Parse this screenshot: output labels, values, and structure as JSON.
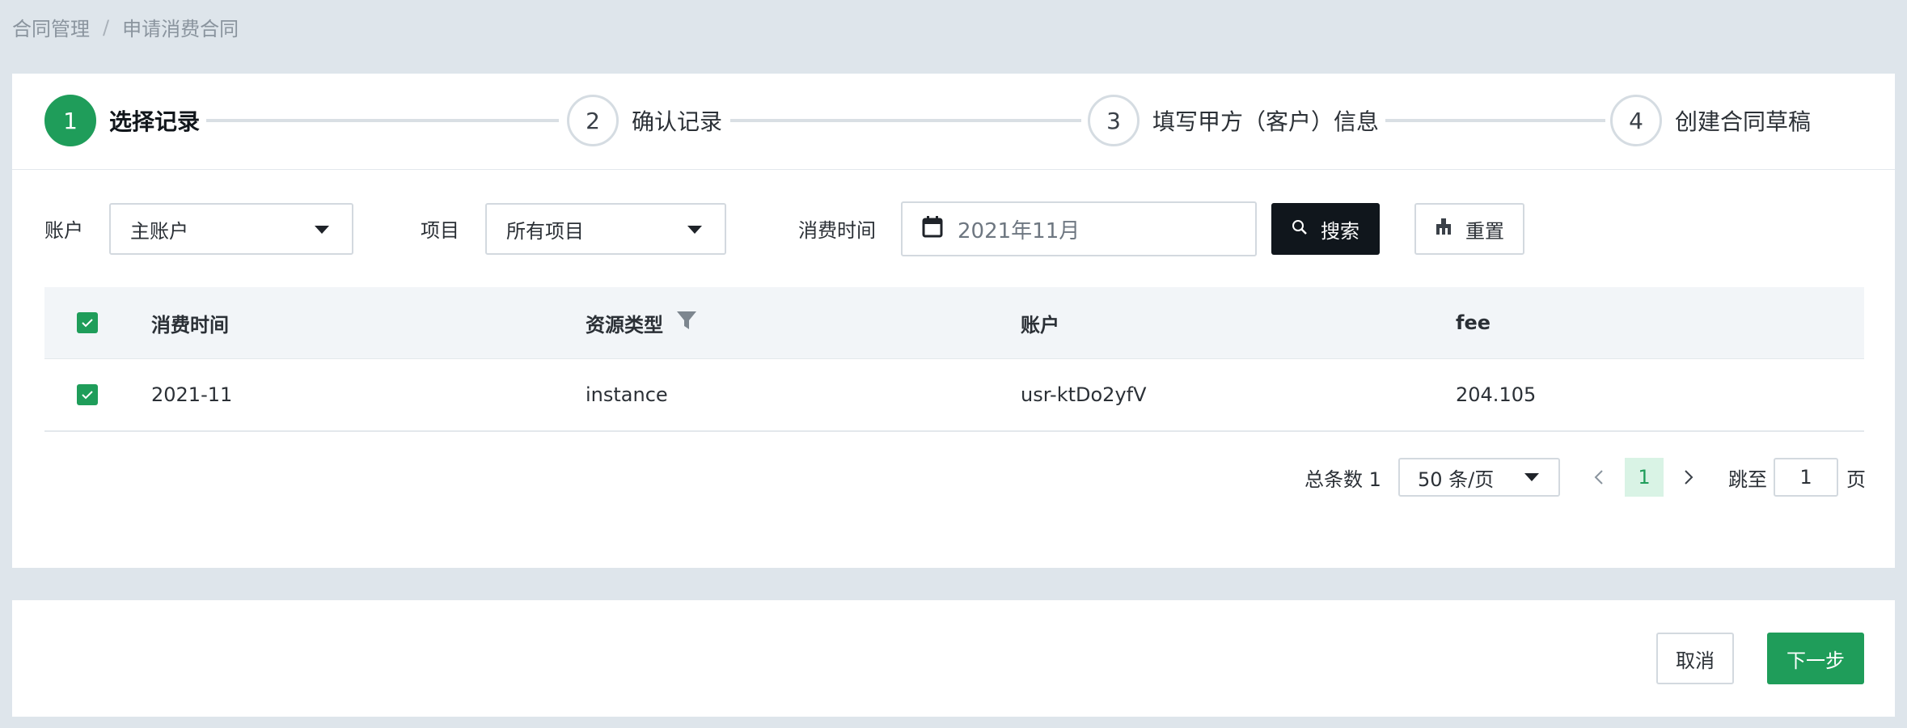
{
  "breadcrumb": {
    "items": [
      "合同管理",
      "申请消费合同"
    ],
    "separator": "/"
  },
  "steps": [
    {
      "num": "1",
      "label": "选择记录"
    },
    {
      "num": "2",
      "label": "确认记录"
    },
    {
      "num": "3",
      "label": "填写甲方（客户）信息"
    },
    {
      "num": "4",
      "label": "创建合同草稿"
    }
  ],
  "filters": {
    "account_label": "账户",
    "account_value": "主账户",
    "project_label": "项目",
    "project_value": "所有项目",
    "time_label": "消费时间",
    "time_value": "2021年11月",
    "search_label": "搜索",
    "reset_label": "重置"
  },
  "table": {
    "columns": [
      "消费时间",
      "资源类型",
      "账户",
      "fee"
    ],
    "rows": [
      {
        "time": "2021-11",
        "type": "instance",
        "account": "usr-ktDo2yfV",
        "fee": "204.105"
      }
    ]
  },
  "pagination": {
    "total_text": "总条数 1",
    "page_size": "50 条/页",
    "current_page": "1",
    "jump_label": "跳至",
    "jump_value": "1",
    "page_suffix": "页"
  },
  "footer": {
    "cancel_label": "取消",
    "next_label": "下一步"
  },
  "colors": {
    "accent": "#1f9d5a",
    "dark_button": "#10161c",
    "background": "#dee5eb"
  }
}
